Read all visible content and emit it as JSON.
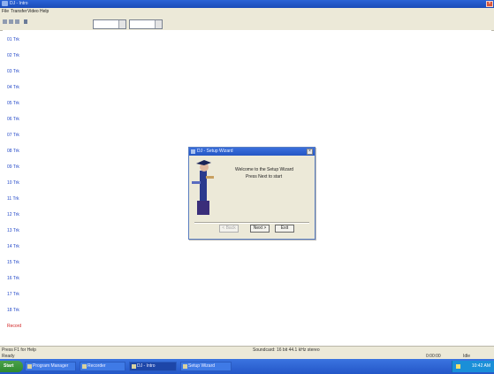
{
  "window": {
    "title": "DJ - Intro"
  },
  "menu": [
    "File",
    "Transfer",
    "Video",
    "Help"
  ],
  "tracks": [
    "01 Trk",
    "02 Trk",
    "03 Trk",
    "04 Trk",
    "05 Trk",
    "06 Trk",
    "07 Trk",
    "08 Trk",
    "09 Trk",
    "10 Trk",
    "11 Trk",
    "12 Trk",
    "13 Trk",
    "14 Trk",
    "15 Trk",
    "16 Trk",
    "17 Trk",
    "18 Trk",
    "Record"
  ],
  "dialog": {
    "title": "DJ - Setup Wizard",
    "line1": "Welcome to the Setup Wizard",
    "line2": "Press Next to start",
    "buttons": {
      "back": "< Back",
      "next": "Next >",
      "exit": "Exit"
    }
  },
  "status": {
    "left1": "Press F1 for Help",
    "left2": "Ready",
    "center": "Soundcard: 16 bit 44.1 kHz stereo",
    "right1": "0:00:00",
    "right2": "Idle"
  },
  "taskbar": {
    "start": "Start",
    "items": [
      "Program Manager",
      "Recorder",
      "DJ - Intro",
      "Setup Wizard"
    ],
    "clock": "10:42 AM"
  },
  "colors": {
    "track_text": "#2248c8",
    "record_text": "#d02020",
    "titlebar": "#2456c4"
  }
}
